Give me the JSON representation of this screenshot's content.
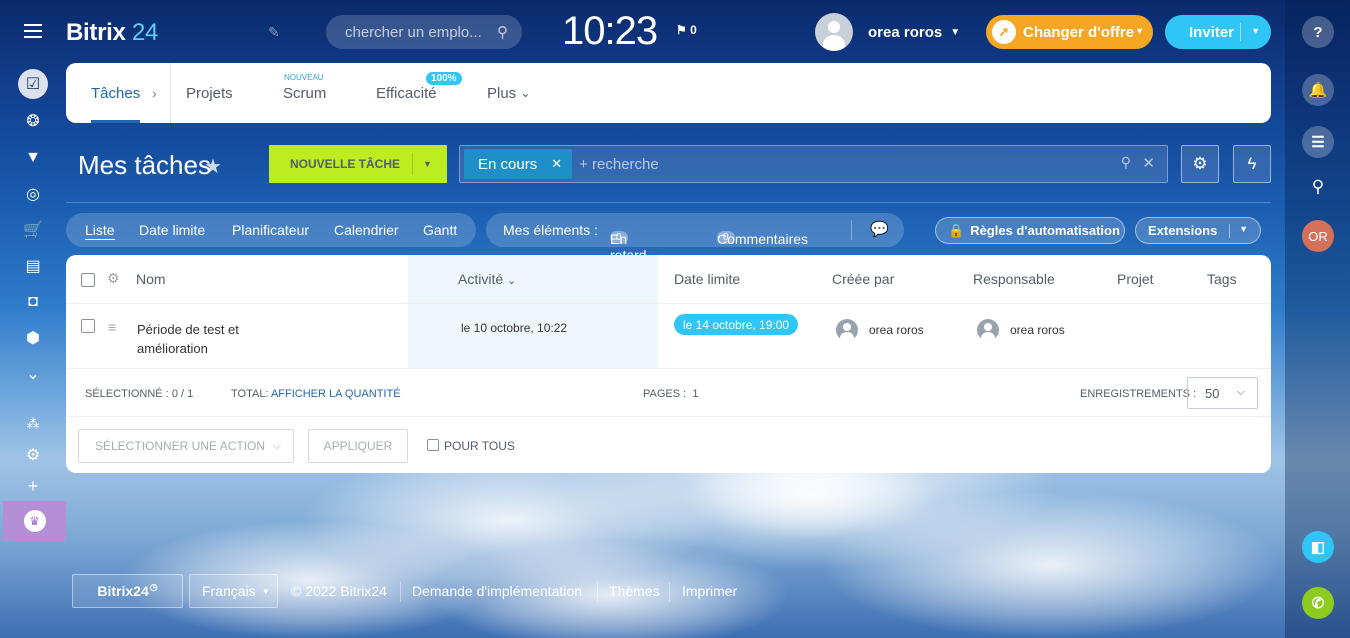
{
  "header": {
    "logo_main": "Bitrix",
    "logo_num": "24",
    "search_placeholder": "chercher un emplo...",
    "clock": "10:23",
    "flag_count": "0",
    "user_name": "orea roros",
    "offer_button": "Changer d'offre",
    "invite_button": "Inviter"
  },
  "right_bar": {
    "help": "?",
    "user_initials": "OR"
  },
  "tabs": {
    "tasks": "Tâches",
    "projects": "Projets",
    "scrum": "Scrum",
    "scrum_badge": "NOUVEAU",
    "efficiency": "Efficacité",
    "efficiency_badge": "100%",
    "more": "Plus"
  },
  "toolbar": {
    "page_title": "Mes tâches",
    "new_task": "NOUVELLE TÂCHE",
    "filter_chip": "En cours",
    "filter_placeholder": "+ recherche"
  },
  "views": {
    "list": "Liste",
    "deadline": "Date limite",
    "planner": "Planificateur",
    "calendar": "Calendrier",
    "gantt": "Gantt"
  },
  "my_items": {
    "label": "Mes éléments :",
    "overdue_count": "0",
    "overdue": "En retard",
    "comments_count": "0",
    "comments": "Commentaires"
  },
  "buttons": {
    "automation": "Règles d'automatisation",
    "extensions": "Extensions"
  },
  "grid": {
    "columns": [
      "Nom",
      "Activité",
      "Date limite",
      "Créée par",
      "Responsable",
      "Projet",
      "Tags"
    ],
    "rows": [
      {
        "name_line1": "Période de test et",
        "name_line2": "amélioration",
        "activity": "le 10 octobre, 10:22",
        "deadline": "le 14 octobre, 19:00",
        "created_by": "orea roros",
        "responsible": "orea roros"
      }
    ],
    "selected_label": "SÉLECTIONNÉ :",
    "selected_value": "0 / 1",
    "total_label": "TOTAL:",
    "total_link": "AFFICHER LA QUANTITÉ",
    "pages_label": "PAGES :",
    "pages_value": "1",
    "records_label": "ENREGISTREMENTS :",
    "records_value": "50",
    "action_select": "SÉLECTIONNER UNE ACTION",
    "apply": "APPLIQUER",
    "for_all": "POUR TOUS"
  },
  "footer": {
    "brand": "Bitrix24",
    "language": "Français",
    "copyright": "© 2022 Bitrix24",
    "implementation": "Demande d'implémentation",
    "themes": "Thèmes",
    "print": "Imprimer"
  }
}
